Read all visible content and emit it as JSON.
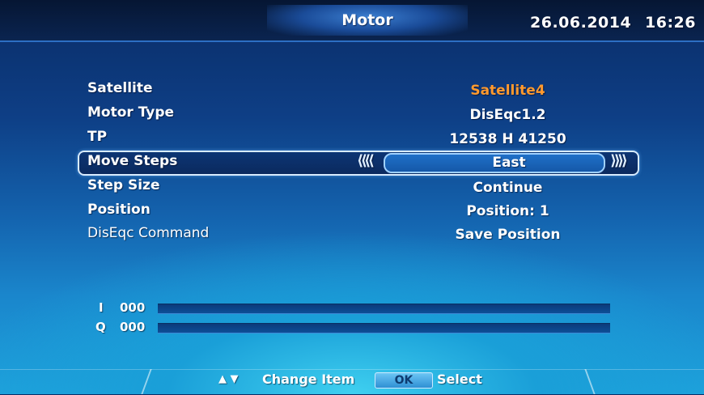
{
  "header": {
    "title": "Motor",
    "date": "26.06.2014",
    "time": "16:26"
  },
  "settings": [
    {
      "label": "Satellite",
      "value": "Satellite4"
    },
    {
      "label": "Motor Type",
      "value": "DisEqc1.2"
    },
    {
      "label": "TP",
      "value": "12538 H 41250"
    },
    {
      "label": "Move Steps",
      "value": "East"
    },
    {
      "label": "Step Size",
      "value": "Continue"
    },
    {
      "label": "Position",
      "value": "Position: 1"
    },
    {
      "label": "DisEqc Command",
      "value": "Save Position"
    }
  ],
  "signal": {
    "i_label": "I",
    "i_value": "000",
    "q_label": "Q",
    "q_value": "000"
  },
  "footer": {
    "change_item": "Change Item",
    "ok_label": "OK",
    "select": "Select"
  },
  "colors": {
    "highlight_value": "#ff9a2e",
    "selection_border": "#d8ecff"
  },
  "icons": {
    "left_arrow": "double-chevron-left-icon",
    "right_arrow": "double-chevron-right-icon",
    "up_down": "up-down-triangle-icon"
  }
}
